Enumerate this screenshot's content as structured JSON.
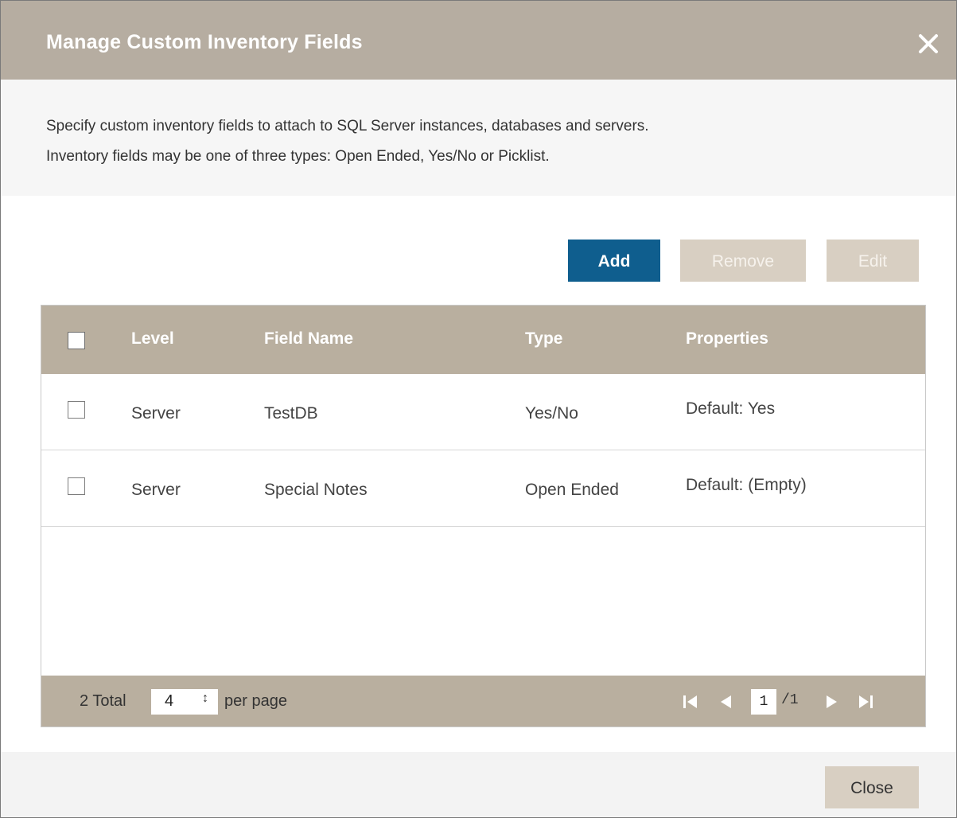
{
  "dialog": {
    "title": "Manage Custom Inventory Fields",
    "close_icon": "close-icon"
  },
  "description": {
    "line1": "Specify custom inventory fields to attach to SQL Server instances, databases and servers.",
    "line2": "Inventory fields may be one of three types: Open Ended, Yes/No or Picklist."
  },
  "toolbar": {
    "add_label": "Add",
    "remove_label": "Remove",
    "edit_label": "Edit",
    "add_enabled": true,
    "remove_enabled": false,
    "edit_enabled": false
  },
  "grid": {
    "columns": {
      "level": "Level",
      "field_name": "Field Name",
      "type": "Type",
      "properties": "Properties"
    },
    "rows": [
      {
        "level": "Server",
        "field_name": "TestDB",
        "type": "Yes/No",
        "properties": "Default: Yes",
        "checked": false
      },
      {
        "level": "Server",
        "field_name": "Special Notes",
        "type": "Open Ended",
        "properties": "Default: (Empty)",
        "checked": false
      }
    ]
  },
  "pager": {
    "total_text": "2 Total",
    "page_size": "4",
    "per_page_label": "per page",
    "current_page": "1",
    "page_count_text": "/1"
  },
  "footer": {
    "close_label": "Close"
  },
  "colors": {
    "titlebar": "#b6ada1",
    "accent": "#0f5e8e",
    "grid_header": "#b9af9f",
    "disabled_button": "#d8cfc2"
  }
}
